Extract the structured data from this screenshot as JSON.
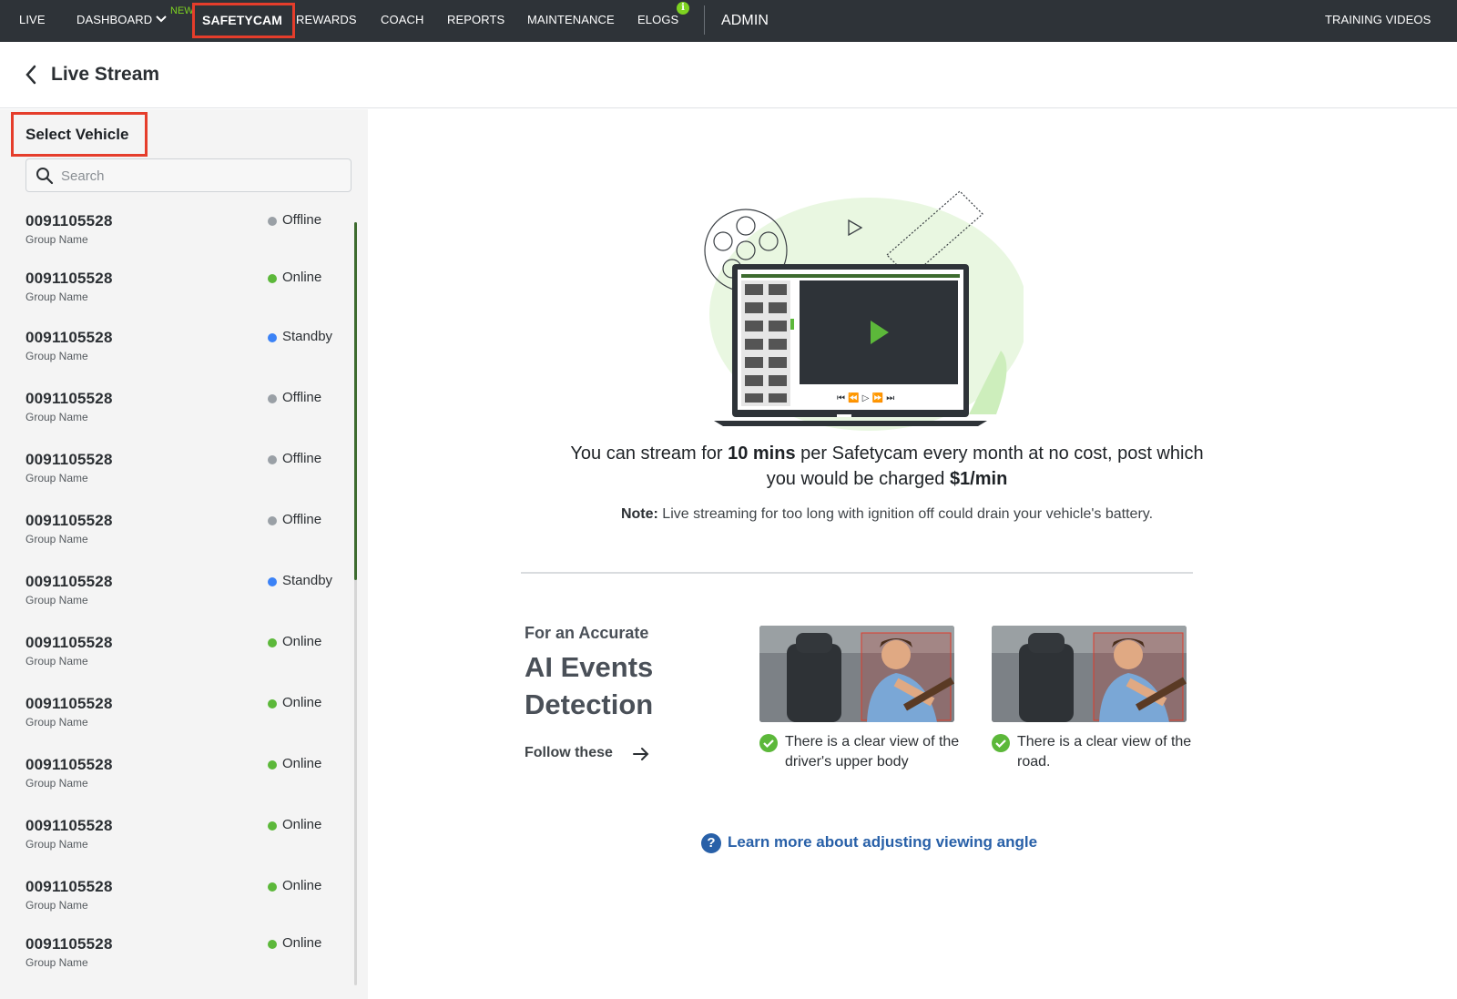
{
  "topnav": {
    "items": [
      "LIVE",
      "DASHBOARD",
      "SAFETYCAM",
      "REWARDS",
      "COACH",
      "REPORTS",
      "MAINTENANCE",
      "ELOGS"
    ],
    "new_badge": "NEW",
    "admin": "ADMIN",
    "training": "TRAINING VIDEOS",
    "elogs_info": "i",
    "active": "SAFETYCAM"
  },
  "header": {
    "title": "Live Stream"
  },
  "sidebar": {
    "title": "Select Vehicle",
    "search_placeholder": "Search",
    "vehicles": [
      {
        "id": "0091105528",
        "group": "Group Name",
        "status": "Offline",
        "color": "#9aa0a6"
      },
      {
        "id": "0091105528",
        "group": "Group Name",
        "status": "Online",
        "color": "#5cb83a"
      },
      {
        "id": "0091105528",
        "group": "Group Name",
        "status": "Standby",
        "color": "#3b82f6"
      },
      {
        "id": "0091105528",
        "group": "Group Name",
        "status": "Offline",
        "color": "#9aa0a6"
      },
      {
        "id": "0091105528",
        "group": "Group Name",
        "status": "Offline",
        "color": "#9aa0a6"
      },
      {
        "id": "0091105528",
        "group": "Group Name",
        "status": "Offline",
        "color": "#9aa0a6"
      },
      {
        "id": "0091105528",
        "group": "Group Name",
        "status": "Standby",
        "color": "#3b82f6"
      },
      {
        "id": "0091105528",
        "group": "Group Name",
        "status": "Online",
        "color": "#5cb83a"
      },
      {
        "id": "0091105528",
        "group": "Group Name",
        "status": "Online",
        "color": "#5cb83a"
      },
      {
        "id": "0091105528",
        "group": "Group Name",
        "status": "Online",
        "color": "#5cb83a"
      },
      {
        "id": "0091105528",
        "group": "Group Name",
        "status": "Online",
        "color": "#5cb83a"
      },
      {
        "id": "0091105528",
        "group": "Group Name",
        "status": "Online",
        "color": "#5cb83a"
      },
      {
        "id": "0091105528",
        "group": "Group Name",
        "status": "Online",
        "color": "#5cb83a"
      }
    ]
  },
  "main": {
    "stream_text_1": "You can stream for ",
    "stream_bold_1": "10 mins",
    "stream_text_2": " per Safetycam every month at no cost, post which you would be charged ",
    "stream_bold_2": "$1/min",
    "note_label": "Note:",
    "note_text": " Live streaming for too long with ignition off could drain your vehicle's battery.",
    "accurate_label": "For an Accurate",
    "ai_title": "AI Events Detection",
    "follow": "Follow these",
    "tips": [
      {
        "text": "There is a clear view of the driver's upper body"
      },
      {
        "text": "There is a clear view of the road."
      }
    ],
    "learn_icon": "?",
    "learn_more": "Learn more about adjusting viewing angle"
  },
  "colors": {
    "nav_bg": "#2e3338",
    "highlight": "#e53d2b",
    "online": "#5cb83a",
    "standby": "#3b82f6",
    "offline": "#9aa0a6",
    "link": "#2860a8"
  }
}
